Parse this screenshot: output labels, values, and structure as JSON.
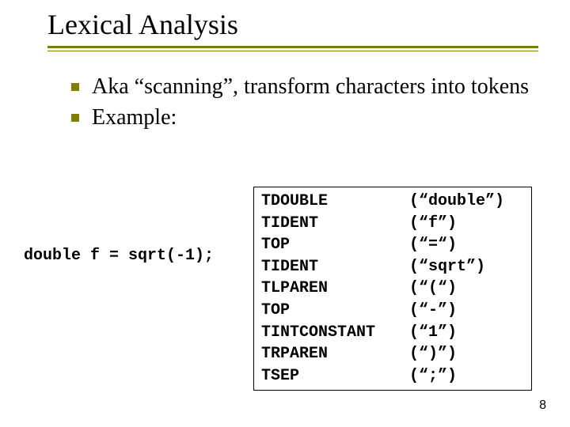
{
  "title": "Lexical Analysis",
  "bullets": [
    "Aka “scanning”, transform characters into tokens",
    "Example:"
  ],
  "code_left": "double f = sqrt(-1);",
  "tokens": [
    {
      "name": "TDOUBLE",
      "lexeme": "(“double”)"
    },
    {
      "name": "TIDENT",
      "lexeme": "(“f”)"
    },
    {
      "name": "TOP",
      "lexeme": "(“=“)"
    },
    {
      "name": "TIDENT",
      "lexeme": "(“sqrt”)"
    },
    {
      "name": "TLPAREN",
      "lexeme": "(“(“)"
    },
    {
      "name": "TOP",
      "lexeme": "(“-”)"
    },
    {
      "name": "TINTCONSTANT",
      "lexeme": "(“1”)"
    },
    {
      "name": "TRPAREN",
      "lexeme": "(“)”)"
    },
    {
      "name": "TSEP",
      "lexeme": "(“;”)"
    }
  ],
  "page_number": "8"
}
